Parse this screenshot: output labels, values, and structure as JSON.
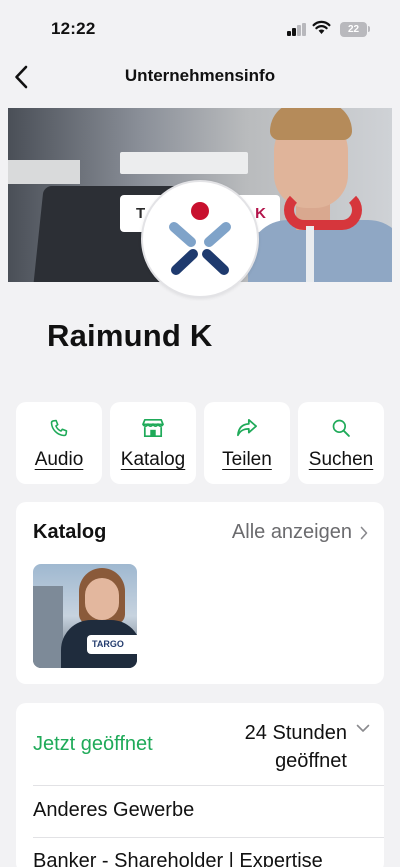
{
  "status_bar": {
    "time": "12:22",
    "battery": "22"
  },
  "header": {
    "title": "Unternehmensinfo"
  },
  "cover": {
    "sign_left": "T",
    "sign_right": "K"
  },
  "profile": {
    "name": "Raimund K"
  },
  "actions": [
    {
      "label": "Audio",
      "icon": "phone-icon"
    },
    {
      "label": "Katalog",
      "icon": "store-icon"
    },
    {
      "label": "Teilen",
      "icon": "share-icon"
    },
    {
      "label": "Suchen",
      "icon": "search-icon"
    }
  ],
  "catalog": {
    "title": "Katalog",
    "see_all": "Alle anzeigen",
    "item_tag": "TARGO"
  },
  "hours": {
    "status": "Jetzt geöffnet",
    "text_line1": "24 Stunden",
    "text_line2": "geöffnet"
  },
  "info": {
    "category": "Anderes Gewerbe",
    "description": "Banker - Shareholder | Expertise"
  },
  "colors": {
    "accent_green": "#1faa59",
    "background": "#f2f2f4",
    "card": "#ffffff"
  }
}
